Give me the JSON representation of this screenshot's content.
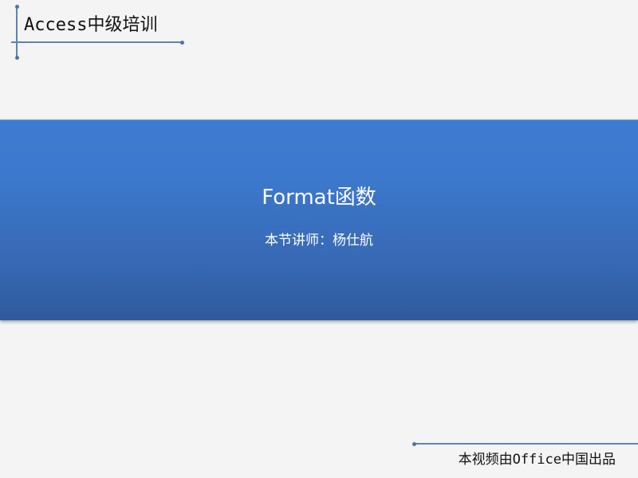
{
  "header": {
    "title": "Access中级培训"
  },
  "banner": {
    "title": "Format函数",
    "subtitle": "本节讲师：杨仕航"
  },
  "footer": {
    "text": "本视频由Office中国出品"
  },
  "colors": {
    "accent_line": "#5b82b9",
    "banner_top": "#3f7bd0",
    "banner_bottom": "#2f5a9c",
    "background": "#f4f4f4"
  }
}
